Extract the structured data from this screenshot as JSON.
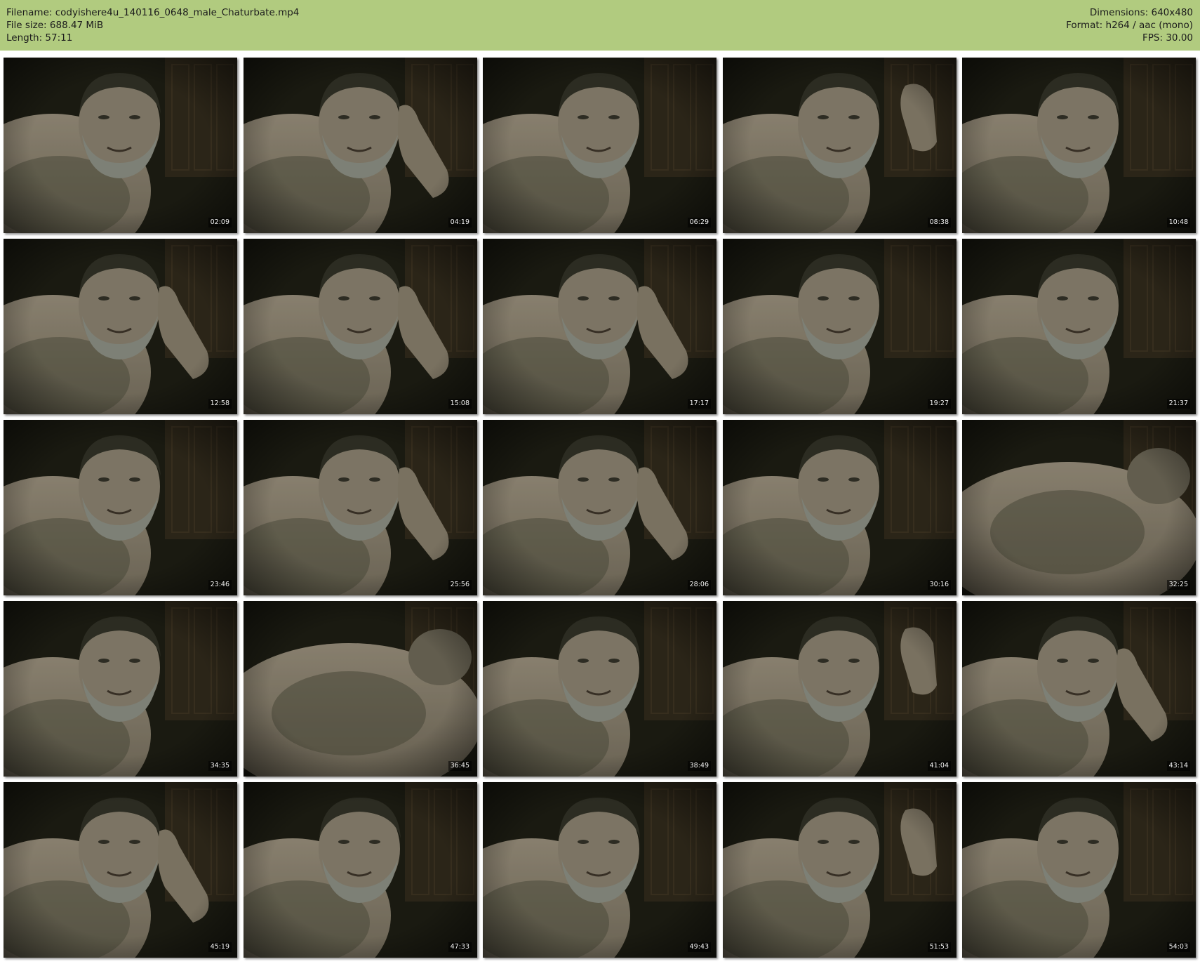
{
  "info": {
    "filename": "Filename: codyishere4u_140116_0648_male_Chaturbate.mp4",
    "filesize": "File size: 688.47 MiB",
    "length": "Length: 57:11",
    "dimensions": "Dimensions: 640x480",
    "format": "Format: h264 / aac (mono)",
    "fps": "FPS: 30.00"
  },
  "colors": {
    "header_bg": "#b1cb7f",
    "page_bg": "#ffffff"
  },
  "thumbnails": [
    {
      "timestamp": "02:09",
      "variant": "face"
    },
    {
      "timestamp": "04:19",
      "variant": "hand"
    },
    {
      "timestamp": "06:29",
      "variant": "face"
    },
    {
      "timestamp": "08:38",
      "variant": "wave"
    },
    {
      "timestamp": "10:48",
      "variant": "face"
    },
    {
      "timestamp": "12:58",
      "variant": "hand"
    },
    {
      "timestamp": "15:08",
      "variant": "hand"
    },
    {
      "timestamp": "17:17",
      "variant": "hand"
    },
    {
      "timestamp": "19:27",
      "variant": "face"
    },
    {
      "timestamp": "21:37",
      "variant": "face"
    },
    {
      "timestamp": "23:46",
      "variant": "face"
    },
    {
      "timestamp": "25:56",
      "variant": "hand"
    },
    {
      "timestamp": "28:06",
      "variant": "hand"
    },
    {
      "timestamp": "30:16",
      "variant": "face"
    },
    {
      "timestamp": "32:25",
      "variant": "chest"
    },
    {
      "timestamp": "34:35",
      "variant": "face"
    },
    {
      "timestamp": "36:45",
      "variant": "chest"
    },
    {
      "timestamp": "38:49",
      "variant": "face"
    },
    {
      "timestamp": "41:04",
      "variant": "wave"
    },
    {
      "timestamp": "43:14",
      "variant": "hand"
    },
    {
      "timestamp": "45:19",
      "variant": "hand"
    },
    {
      "timestamp": "47:33",
      "variant": "face"
    },
    {
      "timestamp": "49:43",
      "variant": "face"
    },
    {
      "timestamp": "51:53",
      "variant": "wave"
    },
    {
      "timestamp": "54:03",
      "variant": "face"
    }
  ]
}
